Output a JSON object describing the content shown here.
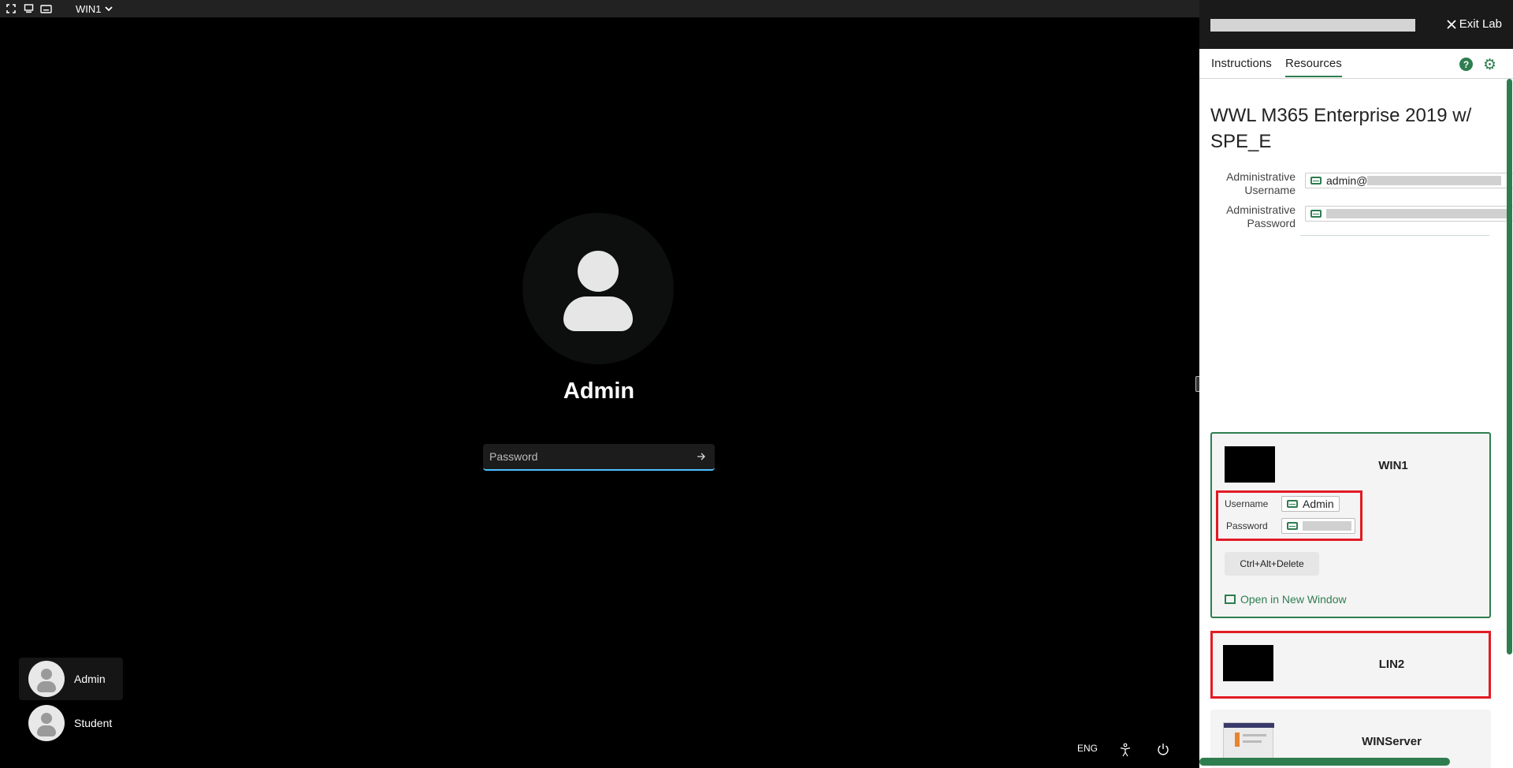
{
  "topbar": {
    "fullscreen_icon": "fullscreen-icon",
    "vm_icon": "monitor-icon",
    "keyboard_icon": "keyboard-icon",
    "vm_selected": "WIN1"
  },
  "login": {
    "username": "Admin",
    "password_placeholder": "Password",
    "users": [
      {
        "label": "Admin"
      },
      {
        "label": "Student"
      }
    ],
    "tray_lang": "ENG"
  },
  "panel": {
    "exit_label": "Exit Lab",
    "tabs": [
      {
        "label": "Instructions"
      },
      {
        "label": "Resources"
      }
    ],
    "lab_title": "WWL M365 Enterprise 2019 w/ SPE_E",
    "admin_username_label": "Administrative Username",
    "admin_username_value": "admin@",
    "admin_password_label": "Administrative Password",
    "vms": [
      {
        "name": "WIN1",
        "username_label": "Username",
        "username_value": "Admin",
        "password_label": "Password",
        "cad_label": "Ctrl+Alt+Delete",
        "open_new_label": "Open in New Window"
      },
      {
        "name": "LIN2"
      },
      {
        "name": "WINServer"
      }
    ]
  },
  "colors": {
    "accent": "#2e7d4f",
    "highlight": "#e21b24",
    "focus": "#4cc2ff"
  }
}
